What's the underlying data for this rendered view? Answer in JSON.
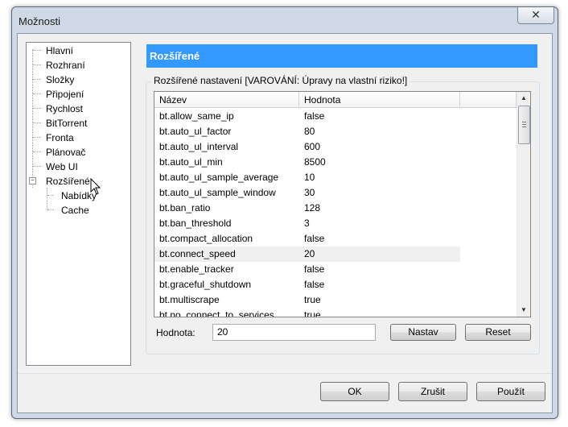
{
  "window": {
    "title": "Možnosti",
    "close_glyph": "✕"
  },
  "nav": {
    "items": [
      {
        "label": "Hlavní"
      },
      {
        "label": "Rozhraní"
      },
      {
        "label": "Složky"
      },
      {
        "label": "Připojení"
      },
      {
        "label": "Rychlost"
      },
      {
        "label": "BitTorrent"
      },
      {
        "label": "Fronta"
      },
      {
        "label": "Plánovač"
      },
      {
        "label": "Web UI"
      },
      {
        "label": "Rozšířené",
        "expanded": true
      },
      {
        "label": "Nabídky"
      },
      {
        "label": "Cache"
      }
    ]
  },
  "panel": {
    "title": "Rozšířené",
    "group_label": "Rozšířené nastavení [VAROVÁNÍ: Úpravy na vlastní riziko!]",
    "columns": [
      "Název",
      "Hodnota"
    ],
    "rows": [
      [
        "bt.allow_same_ip",
        "false"
      ],
      [
        "bt.auto_ul_factor",
        "80"
      ],
      [
        "bt.auto_ul_interval",
        "600"
      ],
      [
        "bt.auto_ul_min",
        "8500"
      ],
      [
        "bt.auto_ul_sample_average",
        "10"
      ],
      [
        "bt.auto_ul_sample_window",
        "30"
      ],
      [
        "bt.ban_ratio",
        "128"
      ],
      [
        "bt.ban_threshold",
        "3"
      ],
      [
        "bt.compact_allocation",
        "false"
      ],
      [
        "bt.connect_speed",
        "20"
      ],
      [
        "bt.enable_tracker",
        "false"
      ],
      [
        "bt.graceful_shutdown",
        "false"
      ],
      [
        "bt.multiscrape",
        "true"
      ],
      [
        "bt.no_connect_to_services",
        "true"
      ]
    ],
    "selected_row_index": 9,
    "value_label": "Hodnota:",
    "value_field": "20",
    "set_button": "Nastav",
    "reset_button": "Reset"
  },
  "footer": {
    "ok": "OK",
    "cancel": "Zrušit",
    "apply": "Použít"
  },
  "colors": {
    "header": "#3399ff",
    "window_frame": "#cfd9e6"
  }
}
